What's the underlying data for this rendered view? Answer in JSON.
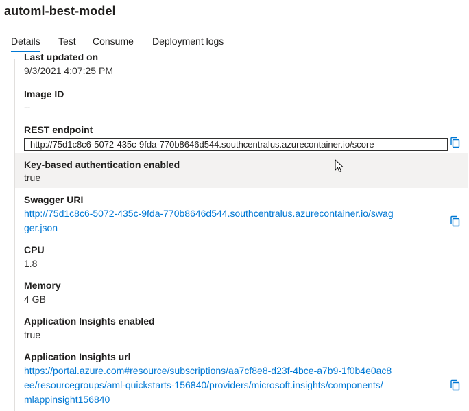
{
  "title": "automl-best-model",
  "tabs": [
    {
      "label": "Details"
    },
    {
      "label": "Test"
    },
    {
      "label": "Consume"
    },
    {
      "label": "Deployment logs"
    }
  ],
  "details": {
    "last_updated": {
      "label": "Last updated on",
      "value": "9/3/2021 4:07:25 PM"
    },
    "image_id": {
      "label": "Image ID",
      "value": "--"
    },
    "rest_endpoint": {
      "label": "REST endpoint",
      "value": "http://75d1c8c6-5072-435c-9fda-770b8646d544.southcentralus.azurecontainer.io/score"
    },
    "key_auth": {
      "label": "Key-based authentication enabled",
      "value": "true"
    },
    "swagger": {
      "label": "Swagger URI",
      "value_line1": "http://75d1c8c6-5072-435c-9fda-770b8646d544.southcentralus.azurecontainer.io/swag",
      "value_line2": "ger.json"
    },
    "cpu": {
      "label": "CPU",
      "value": "1.8"
    },
    "memory": {
      "label": "Memory",
      "value": "4 GB"
    },
    "app_insights_enabled": {
      "label": "Application Insights enabled",
      "value": "true"
    },
    "app_insights_url": {
      "label": "Application Insights url",
      "value_line1": "https://portal.azure.com#resource/subscriptions/aa7cf8e8-d23f-4bce-a7b9-1f0b4e0ac8",
      "value_line2": "ee/resourcegroups/aml-quickstarts-156840/providers/microsoft.insights/components/",
      "value_line3": "mlappinsight156840"
    }
  },
  "colors": {
    "accent": "#0078d4",
    "highlight_row": "#f3f2f1"
  },
  "icons": {
    "copy": "copy-icon",
    "cursor": "mouse-pointer-icon"
  }
}
